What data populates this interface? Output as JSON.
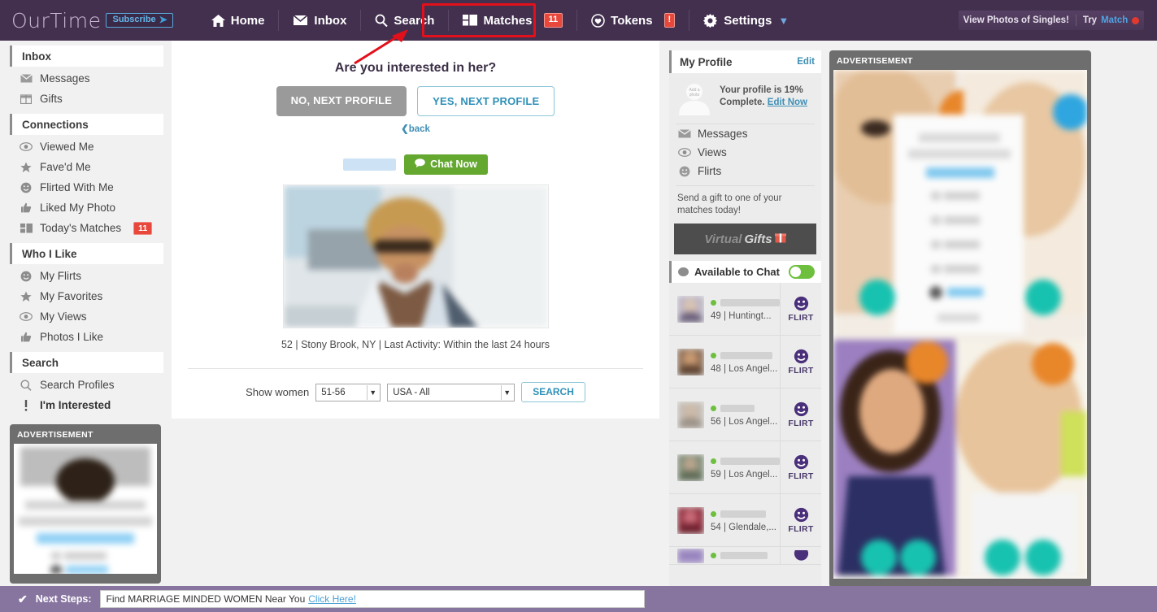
{
  "brand": {
    "logo": "OurTime",
    "subscribe": "Subscribe",
    "accent": "#43304f",
    "badge_color": "#e8483c"
  },
  "topnav": {
    "items": [
      {
        "label": "Home",
        "icon": "home-icon"
      },
      {
        "label": "Inbox",
        "icon": "envelope-icon"
      },
      {
        "label": "Search",
        "icon": "magnifier-icon"
      },
      {
        "label": "Matches",
        "icon": "cards-icon",
        "badge": "11"
      },
      {
        "label": "Tokens",
        "icon": "heart-shield-icon",
        "badge": "!"
      },
      {
        "label": "Settings",
        "icon": "gear-icon"
      }
    ],
    "promo": {
      "text": "View Photos of Singles!",
      "try": "Try",
      "brand": "Match"
    }
  },
  "sidebar": {
    "sections": [
      {
        "title": "Inbox",
        "items": [
          {
            "label": "Messages",
            "icon": "envelope-icon"
          },
          {
            "label": "Gifts",
            "icon": "gift-icon"
          }
        ]
      },
      {
        "title": "Connections",
        "items": [
          {
            "label": "Viewed Me",
            "icon": "eye-icon"
          },
          {
            "label": "Fave'd Me",
            "icon": "star-icon"
          },
          {
            "label": "Flirted With Me",
            "icon": "smiley-icon"
          },
          {
            "label": "Liked My Photo",
            "icon": "thumbs-up-icon"
          },
          {
            "label": "Today's Matches",
            "icon": "cards-icon",
            "badge": "11"
          }
        ]
      },
      {
        "title": "Who I Like",
        "items": [
          {
            "label": "My Flirts",
            "icon": "smiley-icon"
          },
          {
            "label": "My Favorites",
            "icon": "star-icon"
          },
          {
            "label": "My Views",
            "icon": "eye-icon"
          },
          {
            "label": "Photos I Like",
            "icon": "thumbs-up-icon"
          }
        ]
      },
      {
        "title": "Search",
        "items": [
          {
            "label": "Search Profiles",
            "icon": "magnifier-icon"
          },
          {
            "label": "I'm Interested",
            "icon": "exclamation-icon",
            "bold": true
          }
        ]
      }
    ],
    "ad_label": "ADVERTISEMENT"
  },
  "main": {
    "question": "Are you interested in her?",
    "no_label": "NO, NEXT PROFILE",
    "yes_label": "YES, NEXT PROFILE",
    "back_label": "back",
    "chat_now_label": "Chat Now",
    "profile_meta": "52 | Stony Brook, NY | Last Activity: Within the last 24 hours",
    "search": {
      "show_label": "Show women",
      "age_value": "51-56",
      "location_value": "USA - All",
      "button_label": "SEARCH"
    }
  },
  "my_profile": {
    "title": "My Profile",
    "edit_label": "Edit",
    "avatar_label": "Add a photo",
    "complete_line1": "Your profile is 19%",
    "complete_line2": "Complete.",
    "edit_now_label": "Edit Now",
    "links": [
      {
        "label": "Messages",
        "icon": "envelope-icon"
      },
      {
        "label": "Views",
        "icon": "eye-icon"
      },
      {
        "label": "Flirts",
        "icon": "smiley-icon"
      }
    ],
    "gift_text": "Send a gift to one of your matches today!",
    "gift_button": {
      "word1": "Virtual",
      "word2": "Gifts"
    },
    "available_label": "Available to Chat",
    "available_on": true
  },
  "chat_list": {
    "flirt_label": "FLIRT",
    "items": [
      {
        "age": "49",
        "location": "Huntingt...",
        "name_width": 78,
        "online": true
      },
      {
        "age": "48",
        "location": "Los Angel...",
        "name_width": 64,
        "online": true
      },
      {
        "age": "56",
        "location": "Los Angel...",
        "name_width": 42,
        "online": true
      },
      {
        "age": "59",
        "location": "Los Angel...",
        "name_width": 74,
        "online": true
      },
      {
        "age": "54",
        "location": "Glendale,...",
        "name_width": 56,
        "online": true
      }
    ]
  },
  "right_ad": {
    "label": "ADVERTISEMENT"
  },
  "bottom": {
    "next_steps_label": "Next Steps:",
    "input_text": "Find MARRIAGE MINDED WOMEN Near You",
    "input_link": "Click Here!"
  }
}
